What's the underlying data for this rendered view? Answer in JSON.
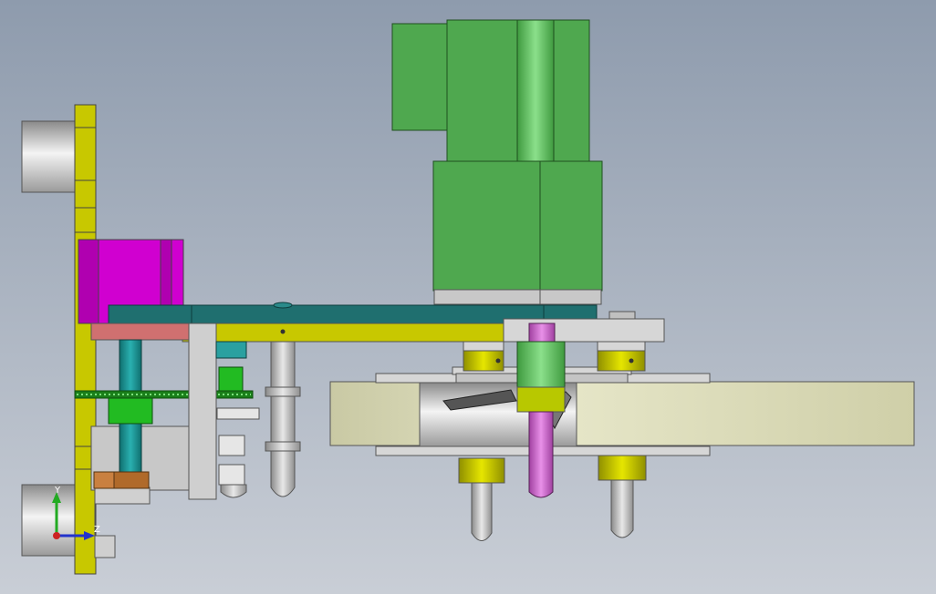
{
  "axis_triad": {
    "y_label": "Y",
    "z_label": "Z",
    "y_color": "#22aa22",
    "z_color": "#2233cc",
    "origin_color": "#cc2222"
  },
  "colors": {
    "background_top": "#8e9bad",
    "background_bottom": "#c9ced6",
    "plate_yellow": "#c8c800",
    "motor_green": "#4fa84f",
    "magenta_block": "#d000d0",
    "teal_plate": "#1f6f6f",
    "disc_khaki": "#d8d8b0",
    "rod_pink": "#cc66cc",
    "rod_teal": "#1a8f8f"
  }
}
